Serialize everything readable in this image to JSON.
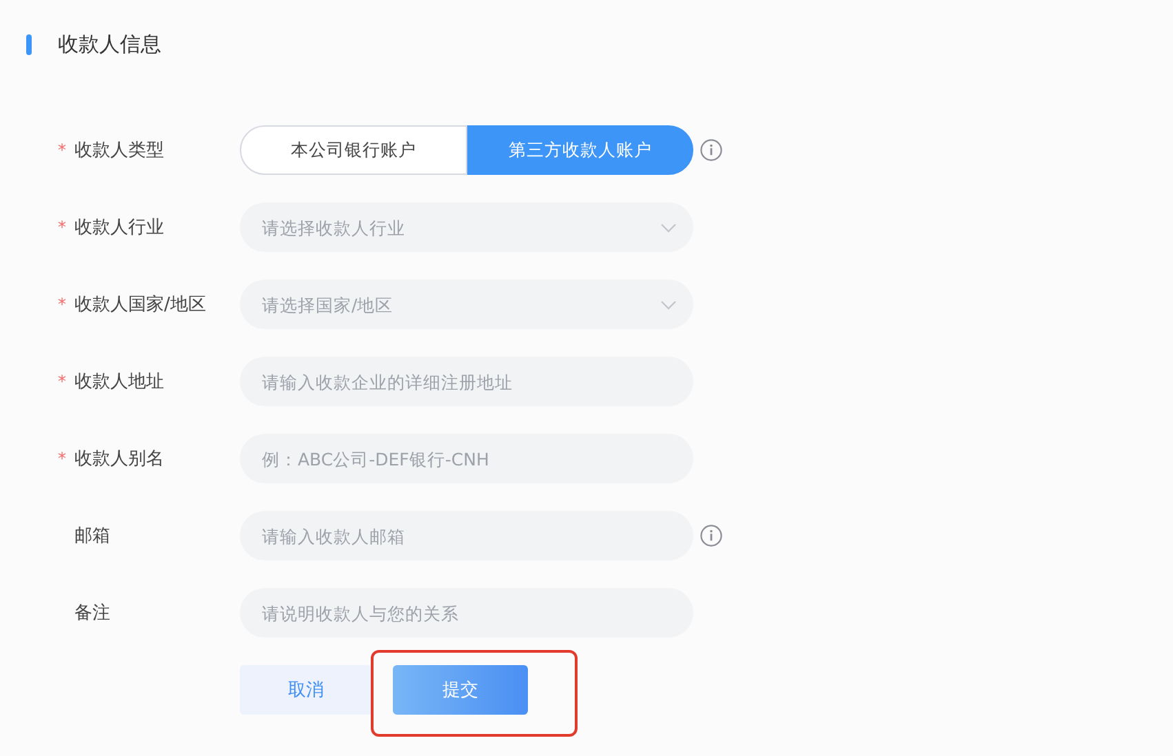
{
  "section": {
    "title": "收款人信息"
  },
  "fields": [
    {
      "kind": "segmented",
      "label": "收款人类型",
      "required_mark": "*",
      "info": true,
      "options": [
        {
          "label": "本公司银行账户",
          "selected": false
        },
        {
          "label": "第三方收款人账户",
          "selected": true
        }
      ]
    },
    {
      "kind": "select",
      "label": "收款人行业",
      "required_mark": "*",
      "info": false,
      "placeholder": "请选择收款人行业"
    },
    {
      "kind": "select",
      "label": "收款人国家/地区",
      "required_mark": "*",
      "info": false,
      "placeholder": "请选择国家/地区"
    },
    {
      "kind": "input",
      "label": "收款人地址",
      "required_mark": "*",
      "info": false,
      "placeholder": "请输入收款企业的详细注册地址"
    },
    {
      "kind": "input",
      "label": "收款人别名",
      "required_mark": "*",
      "info": false,
      "placeholder": "例：ABC公司-DEF银行-CNH"
    },
    {
      "kind": "input",
      "label": "邮箱",
      "info": true,
      "placeholder": "请输入收款人邮箱"
    },
    {
      "kind": "input",
      "label": "备注",
      "info": false,
      "placeholder": "请说明收款人与您的关系"
    }
  ],
  "buttons": [
    {
      "kind": "secondary",
      "label": "取消",
      "highlighted": false
    },
    {
      "kind": "primary",
      "label": "提交",
      "highlighted": true
    }
  ]
}
